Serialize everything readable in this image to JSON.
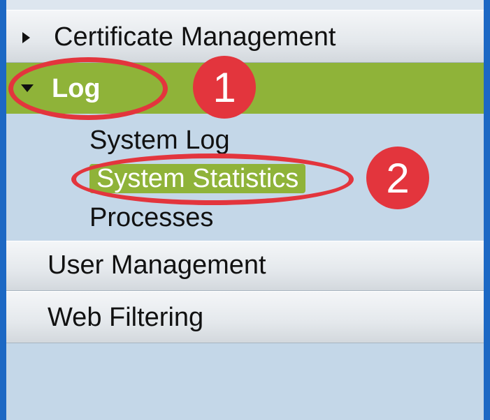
{
  "menu": {
    "certificate_management": "Certificate Management",
    "log": "Log",
    "log_children": {
      "system_log": "System Log",
      "system_statistics": "System Statistics",
      "processes": "Processes"
    },
    "user_management": "User Management",
    "web_filtering": "Web Filtering"
  },
  "annotations": {
    "step_1": "1",
    "step_2": "2"
  },
  "colors": {
    "panel_background": "#c4d7e8",
    "active_green": "#8fb339",
    "annotation_red": "#e3353d",
    "frame_blue": "#1c68c4"
  },
  "icons": {
    "certificate_management": "caret-right-icon",
    "log": "caret-down-icon"
  }
}
